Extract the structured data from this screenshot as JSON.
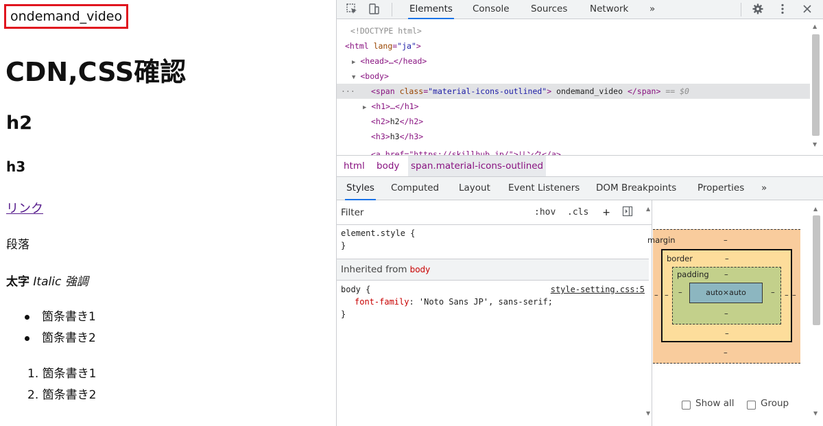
{
  "page": {
    "icon_span": "ondemand_video",
    "h1": "CDN,CSS確認",
    "h2": "h2",
    "h3": "h3",
    "link": "リンク",
    "paragraph": "段落",
    "strong": "太字",
    "italic": "Italic",
    "emphasis": "強調",
    "ul_items": [
      "箇条書き1",
      "箇条書き2"
    ],
    "ol_items": [
      "1. 箇条書き1",
      "2. 箇条書き2"
    ]
  },
  "devtools": {
    "toolbar": {
      "tabs": [
        "Elements",
        "Console",
        "Sources",
        "Network"
      ],
      "more": "»",
      "inspect_icon": "inspect-icon",
      "device_icon": "device-toggle-icon",
      "settings_icon": "gear-icon",
      "menu_icon": "kebab-menu-icon",
      "close_icon": "close-icon"
    },
    "dom": {
      "doctype": "<!DOCTYPE html>",
      "html_open_tag": "<html",
      "html_attr": "lang",
      "html_attr_val": "\"ja\"",
      "head": "<head>…</head>",
      "body_open": "<body>",
      "span_tag": "<span",
      "span_attr": "class",
      "span_attr_val": "\"material-icons-outlined\"",
      "span_text": " ondemand_video ",
      "span_close": "</span>",
      "span_marker": "== $0",
      "h1": "<h1>…</h1>",
      "h2_open": "<h2>",
      "h2_text": "h2",
      "h2_close": "</h2>",
      "h3_open": "<h3>",
      "h3_text": "h3",
      "h3_close": "</h3>",
      "a_partial": "<a href=\"https://skillhub.jp/\">リンク</a>"
    },
    "breadcrumbs": [
      "html",
      "body",
      "span.material-icons-outlined"
    ],
    "sub_tabs": [
      "Styles",
      "Computed",
      "Layout",
      "Event Listeners",
      "DOM Breakpoints",
      "Properties"
    ],
    "sub_more": "»",
    "styles": {
      "filter_placeholder": "Filter",
      "hov": ":hov",
      ".cls": ".cls",
      "add": "+",
      "element_style": "element.style {",
      "close_brace": "}",
      "inherited_label": "Inherited from",
      "inherited_tag": "body",
      "body_selector": "body {",
      "source": "style-setting.css:5",
      "prop_name": "font-family",
      "prop_value": ": 'Noto Sans JP', sans-serif;"
    },
    "box_model": {
      "margin": "margin",
      "border": "border",
      "padding": "padding",
      "content": "auto×auto",
      "dash": "–"
    },
    "computed": {
      "show_all": "Show all",
      "group": "Group"
    }
  }
}
